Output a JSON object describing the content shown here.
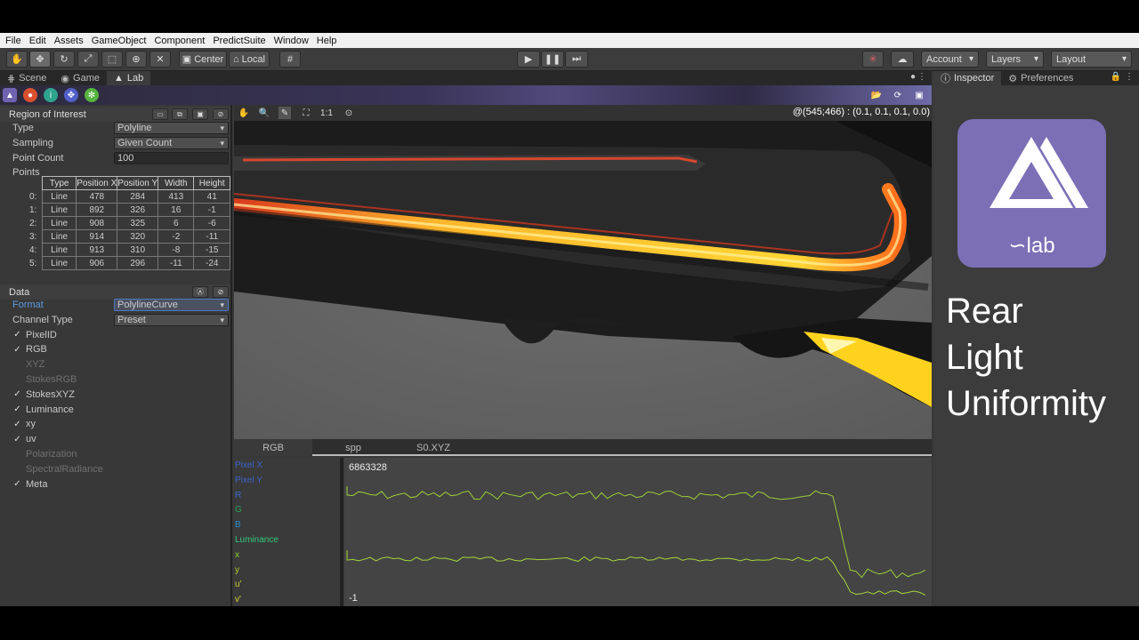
{
  "menu": [
    "File",
    "Edit",
    "Assets",
    "GameObject",
    "Component",
    "PredictSuite",
    "Window",
    "Help"
  ],
  "toolbar": {
    "pivot": "Center",
    "space": "Local",
    "account": "Account",
    "layers": "Layers",
    "layout": "Layout"
  },
  "tabs": [
    "Scene",
    "Game",
    "Lab"
  ],
  "roi": {
    "title": "Region of Interest",
    "type_label": "Type",
    "type_value": "Polyline",
    "sampling_label": "Sampling",
    "sampling_value": "Given Count",
    "count_label": "Point Count",
    "count_value": "100",
    "points_label": "Points",
    "columns": [
      "Type",
      "Position X",
      "Position Y",
      "Width",
      "Height"
    ],
    "rows": [
      {
        "i": "0:",
        "type": "Line",
        "px": "478",
        "py": "284",
        "w": "413",
        "h": "41"
      },
      {
        "i": "1:",
        "type": "Line",
        "px": "892",
        "py": "326",
        "w": "16",
        "h": "-1"
      },
      {
        "i": "2:",
        "type": "Line",
        "px": "908",
        "py": "325",
        "w": "6",
        "h": "-6"
      },
      {
        "i": "3:",
        "type": "Line",
        "px": "914",
        "py": "320",
        "w": "-2",
        "h": "-11"
      },
      {
        "i": "4:",
        "type": "Line",
        "px": "913",
        "py": "310",
        "w": "-8",
        "h": "-15"
      },
      {
        "i": "5:",
        "type": "Line",
        "px": "906",
        "py": "296",
        "w": "-11",
        "h": "-24"
      }
    ]
  },
  "data": {
    "title": "Data",
    "format_label": "Format",
    "format_value": "PolylineCurve",
    "channel_label": "Channel Type",
    "channel_value": "Preset",
    "checks": [
      {
        "label": "PixelID",
        "checked": true
      },
      {
        "label": "RGB",
        "checked": true
      },
      {
        "label": "XYZ",
        "checked": false
      },
      {
        "label": "StokesRGB",
        "checked": false
      },
      {
        "label": "StokesXYZ",
        "checked": true
      },
      {
        "label": "Luminance",
        "checked": true
      },
      {
        "label": "xy",
        "checked": true
      },
      {
        "label": "uv",
        "checked": true
      },
      {
        "label": "Polarization",
        "checked": false
      },
      {
        "label": "SpectralRadiance",
        "checked": false
      },
      {
        "label": "Meta",
        "checked": true
      }
    ]
  },
  "viewport": {
    "coord": "@(545;466) : (0.1, 0.1, 0.1, 0.0)",
    "zoom_label": "1:1"
  },
  "channel_tabs": [
    "RGB",
    "spp",
    "S0.XYZ"
  ],
  "plot": {
    "legend": [
      {
        "label": "Pixel X",
        "color": "#3a63c8"
      },
      {
        "label": "Pixel Y",
        "color": "#3a63c8"
      },
      {
        "label": "R",
        "color": "#3a63c8"
      },
      {
        "label": "G",
        "color": "#24a05a"
      },
      {
        "label": "B",
        "color": "#2a8ad0"
      },
      {
        "label": "Luminance",
        "color": "#35c77a"
      },
      {
        "label": "x",
        "color": "#8bd12e"
      },
      {
        "label": "y",
        "color": "#b3d22a"
      },
      {
        "label": "u'",
        "color": "#c6d02b"
      },
      {
        "label": "v'",
        "color": "#d8d42c"
      }
    ],
    "max_label": "6863328",
    "min_label": "-1"
  },
  "right": {
    "tab_inspector": "Inspector",
    "tab_prefs": "Preferences",
    "logo_text": "∽lab",
    "title_lines": [
      "Rear",
      "Light",
      "Uniformity"
    ]
  }
}
